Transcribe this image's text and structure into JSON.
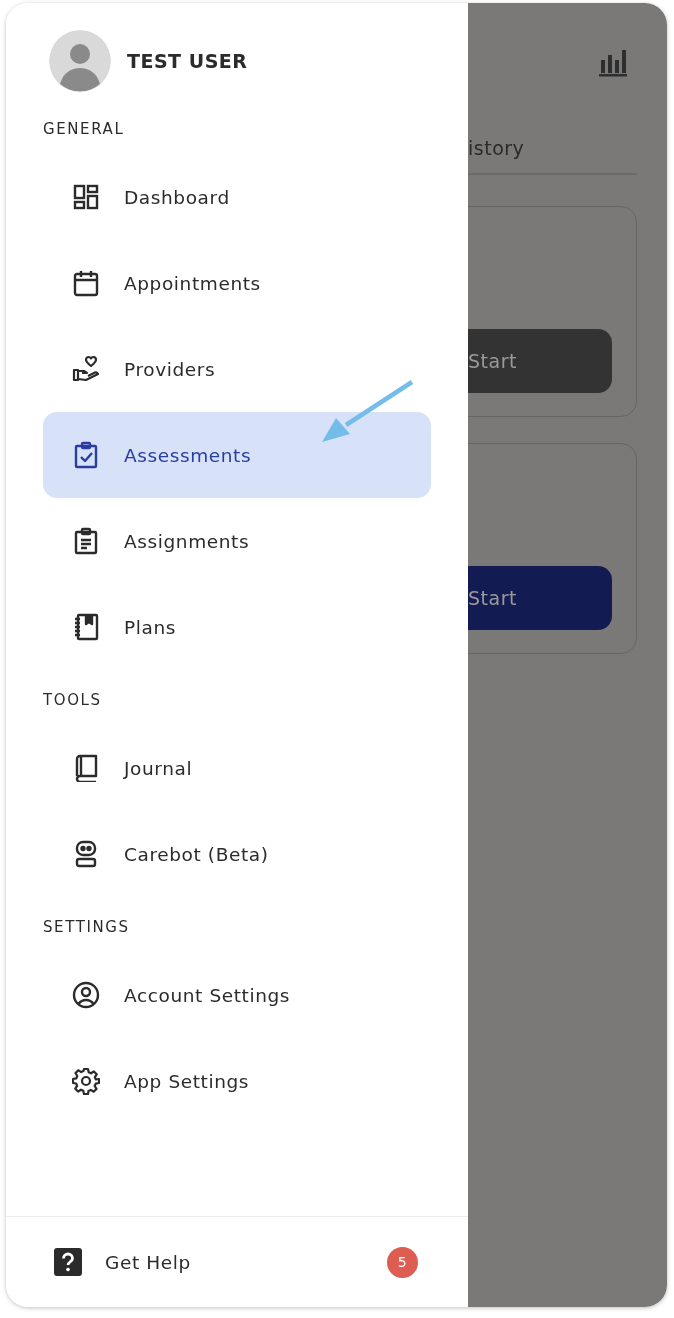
{
  "user": {
    "name": "TEST USER"
  },
  "sections": [
    {
      "title": "GENERAL",
      "items": [
        {
          "label": "Dashboard",
          "kind": "dashboard",
          "selected": false
        },
        {
          "label": "Appointments",
          "kind": "calendar",
          "selected": false
        },
        {
          "label": "Providers",
          "kind": "hand-heart",
          "selected": false
        },
        {
          "label": "Assessments",
          "kind": "clipboard-check",
          "selected": true
        },
        {
          "label": "Assignments",
          "kind": "clipboard-list",
          "selected": false
        },
        {
          "label": "Plans",
          "kind": "notebook",
          "selected": false
        }
      ]
    },
    {
      "title": "TOOLS",
      "items": [
        {
          "label": "Journal",
          "kind": "book",
          "selected": false
        },
        {
          "label": "Carebot (Beta)",
          "kind": "robot",
          "selected": false
        }
      ]
    },
    {
      "title": "SETTINGS",
      "items": [
        {
          "label": "Account Settings",
          "kind": "user-circle",
          "selected": false
        },
        {
          "label": "App Settings",
          "kind": "gear",
          "selected": false
        }
      ]
    }
  ],
  "footer": {
    "label": "Get Help",
    "badge": "5"
  },
  "background": {
    "tab_label": "istory",
    "cards": [
      {
        "button": "Start",
        "kind": "dark"
      },
      {
        "button": "Start",
        "kind": "primary"
      }
    ]
  }
}
